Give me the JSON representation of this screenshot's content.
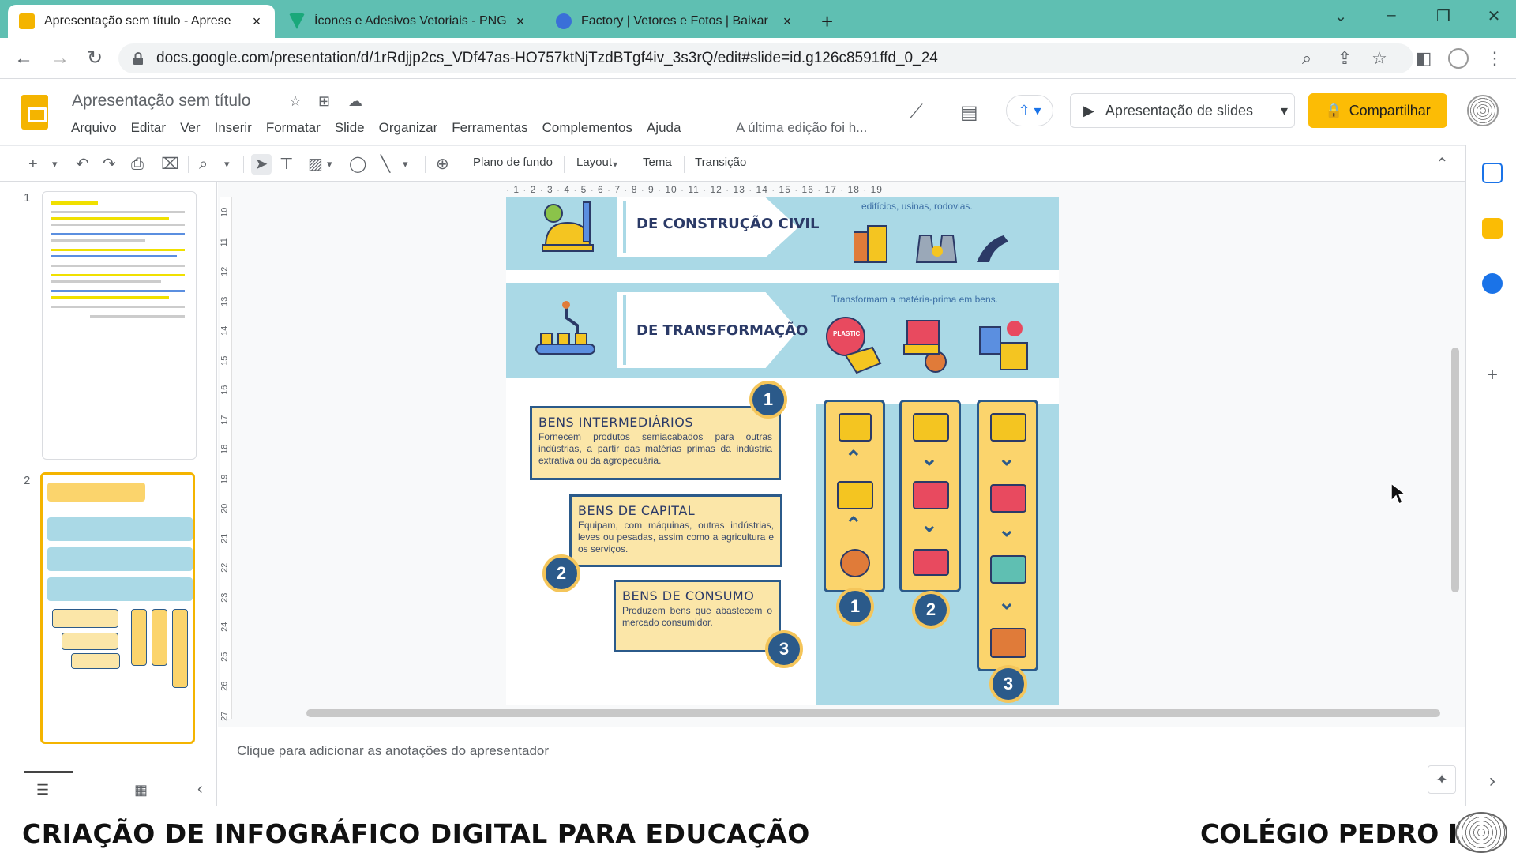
{
  "browser": {
    "tabs": [
      {
        "title": "Apresentação sem título - Aprese",
        "active": true
      },
      {
        "title": "Ícones e Adesivos Vetoriais - PNG",
        "active": false
      },
      {
        "title": "Factory | Vetores e Fotos | Baixar",
        "active": false
      }
    ],
    "new_tab_label": "+",
    "url": "docs.google.com/presentation/d/1rRdjjp2cs_VDf47as-HO757ktNjTzdBTgf4iv_3s3rQ/edit#slide=id.g126c8591ffd_0_24"
  },
  "doc": {
    "title": "Apresentação sem título",
    "menu": [
      "Arquivo",
      "Editar",
      "Ver",
      "Inserir",
      "Formatar",
      "Slide",
      "Organizar",
      "Ferramentas",
      "Complementos",
      "Ajuda"
    ],
    "last_edit": "A última edição foi h...",
    "present_label": "Apresentação de slides",
    "share_label": "Compartilhar"
  },
  "toolbar": {
    "background": "Plano de fundo",
    "layout": "Layout",
    "theme": "Tema",
    "transition": "Transição"
  },
  "ruler_top": "· 1 · 2 · 3 · 4 · 5 · 6 · 7 · 8 · 9 · 10 · 11 · 12 · 13 · 14 · 15 · 16 · 17 · 18 · 19",
  "ruler_left": [
    "10",
    "11",
    "12",
    "13",
    "14",
    "15",
    "16",
    "17",
    "18",
    "19",
    "20",
    "21",
    "22",
    "23",
    "24",
    "25",
    "26",
    "27"
  ],
  "filmstrip": {
    "slide_numbers": [
      "1",
      "2"
    ]
  },
  "slide": {
    "construcao_label": "DE CONSTRUÇÃO CIVIL",
    "construcao_sub": "edifícios, usinas, rodovias.",
    "transformacao_label": "DE TRANSFORMAÇÃO",
    "transformacao_sub": "Transformam a matéria-prima em bens.",
    "boxes": [
      {
        "title": "BENS INTERMEDIÁRIOS",
        "text": "Fornecem produtos semiacabados para outras indústrias, a partir das matérias primas da indústria extrativa ou da agropecuária.",
        "badge": "1"
      },
      {
        "title": "BENS DE CAPITAL",
        "text": "Equipam, com máquinas, outras indústrias, leves ou pesadas, assim como a agricultura e os serviços.",
        "badge": "2"
      },
      {
        "title": "BENS DE CONSUMO",
        "text": "Produzem bens que abastecem o mercado consumidor.",
        "badge": "3"
      }
    ],
    "column_badges": [
      "1",
      "2",
      "3"
    ],
    "plastic_label": "PLASTIC"
  },
  "notes_placeholder": "Clique para adicionar as anotações do apresentador",
  "footer": {
    "left": "CRIAÇÃO DE INFOGRÁFICO DIGITAL PARA EDUCAÇÃO",
    "right": "COLÉGIO PEDRO II"
  },
  "colors": {
    "tabbar": "#5fbfb2",
    "share": "#fcbc05",
    "slide_band": "#aad9e6",
    "box_fill": "#fbe6a8",
    "navy": "#2b5a8a"
  }
}
